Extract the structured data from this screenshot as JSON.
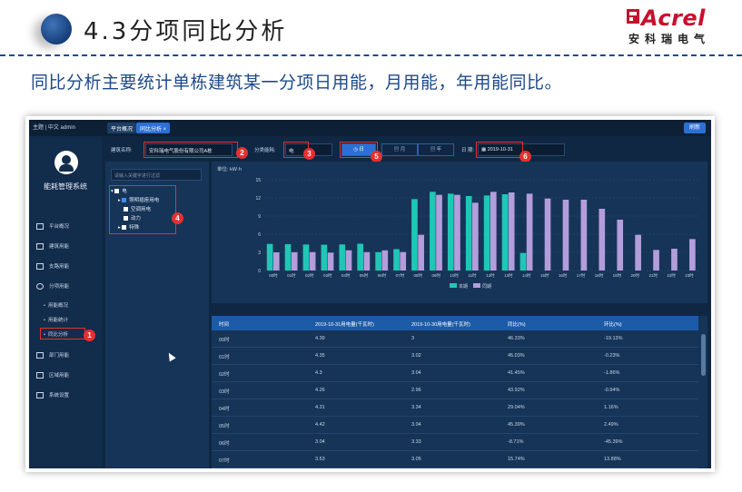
{
  "slide": {
    "section_title": "4.3分项同比分析",
    "intro": "同比分析主要统计单栋建筑某一分项日用能，月用能，年用能同比。",
    "logo_text": "Acrel",
    "logo_sub": "安科瑞电气"
  },
  "app": {
    "topbar": {
      "left_text": "主题 | 中文  admin",
      "tab1": "平台概况",
      "tab2": "同比分析 ×",
      "reset": "刷新"
    },
    "sidebar": {
      "system_name": "能耗管理系统",
      "items": [
        {
          "label": "平台概况"
        },
        {
          "label": "建筑用能"
        },
        {
          "label": "支路用能"
        },
        {
          "label": "分项用能"
        }
      ],
      "subitems": [
        {
          "label": "用能概况"
        },
        {
          "label": "用能统计"
        },
        {
          "label": "同比分析"
        }
      ],
      "items2": [
        {
          "label": "部门用能"
        },
        {
          "label": "区域用能"
        },
        {
          "label": "系统设置"
        }
      ]
    },
    "filters": {
      "building_label": "建筑名称:",
      "building_value": "安科瑞电气股份有限公司A栋",
      "category_label": "分类能耗:",
      "category_value": "电",
      "day": "日",
      "month": "月",
      "year": "年",
      "date_label": "日 期:",
      "date_value": "2019-10-31"
    },
    "tree": {
      "search_placeholder": "请输入关键字进行过滤",
      "root": "电",
      "children": [
        "照明插座用电",
        "空调用电",
        "动力",
        "特殊"
      ]
    },
    "badges": [
      "1",
      "2",
      "3",
      "4",
      "5",
      "6"
    ],
    "table": {
      "headers": [
        "时间",
        "2019-10-31用电量(千瓦时)",
        "2019-10-30用电量(千瓦时)",
        "同比(%)",
        "环比(%)"
      ],
      "rows": [
        [
          "00时",
          "4.39",
          "3",
          "46.33%",
          "-19.13%"
        ],
        [
          "01时",
          "4.35",
          "3.02",
          "45.03%",
          "-0.23%"
        ],
        [
          "02时",
          "4.3",
          "3.04",
          "41.45%",
          "-1.86%"
        ],
        [
          "03时",
          "4.26",
          "2.96",
          "43.92%",
          "-0.94%"
        ],
        [
          "04时",
          "4.31",
          "3.34",
          "29.04%",
          "1.16%"
        ],
        [
          "05时",
          "4.42",
          "3.04",
          "45.39%",
          "2.49%"
        ],
        [
          "06时",
          "3.04",
          "3.33",
          "-8.71%",
          "-45.39%"
        ],
        [
          "07时",
          "3.53",
          "3.05",
          "15.74%",
          "13.88%"
        ]
      ]
    }
  },
  "chart_data": {
    "type": "bar",
    "unit_label": "单位: kW·h",
    "categories": [
      "00时",
      "01时",
      "02时",
      "03时",
      "04时",
      "05时",
      "06时",
      "07时",
      "08时",
      "09时",
      "10时",
      "11时",
      "12时",
      "13时",
      "14时",
      "15时",
      "16时",
      "17时",
      "18时",
      "19时",
      "20时",
      "21时",
      "22时",
      "23时"
    ],
    "series": [
      {
        "name": "本期",
        "color": "#1fc7b6",
        "values": [
          4.39,
          4.35,
          4.3,
          4.26,
          4.31,
          4.42,
          3.04,
          3.53,
          11.8,
          13.0,
          12.7,
          12.3,
          12.4,
          12.6,
          2.9,
          0,
          0,
          0,
          0,
          0,
          0,
          0,
          0,
          0
        ]
      },
      {
        "name": "同期",
        "color": "#b39ddb",
        "values": [
          3,
          3.02,
          3.04,
          2.96,
          3.34,
          3.04,
          3.33,
          3.05,
          5.9,
          12.5,
          12.5,
          11.2,
          13.0,
          12.9,
          12.7,
          11.9,
          11.7,
          11.7,
          10.2,
          8.4,
          5.9,
          3.4,
          3.6,
          5.2
        ]
      }
    ],
    "yticks": [
      0,
      3,
      6,
      9,
      12,
      15
    ],
    "ylim": [
      0,
      15
    ],
    "legend_position": "bottom"
  }
}
